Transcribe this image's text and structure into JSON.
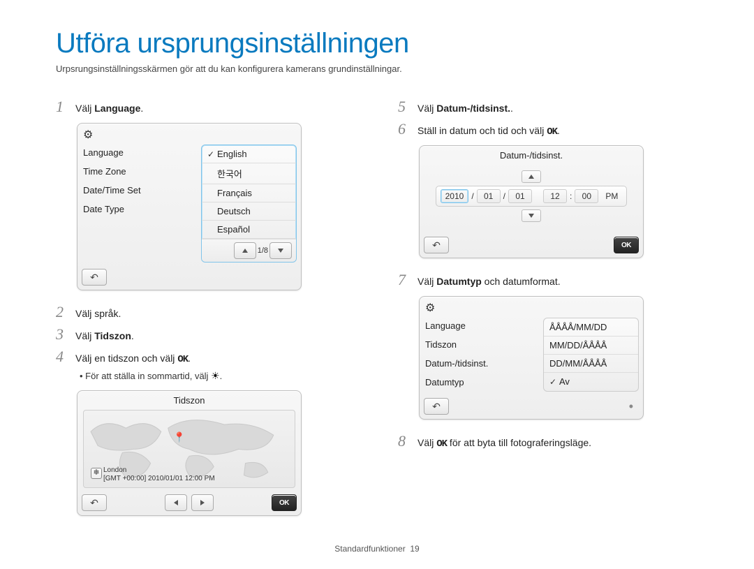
{
  "title": "Utföra ursprungsinställningen",
  "subtitle": "Urpsrungsinställningsskärmen gör att du kan konfigurera kamerans grundinställningar.",
  "footer": {
    "label": "Standardfunktioner",
    "page": "19"
  },
  "steps": {
    "s1": {
      "num": "1",
      "prefix": "Välj ",
      "bold": "Language",
      "suffix": "."
    },
    "s2": {
      "num": "2",
      "text": "Välj språk."
    },
    "s3": {
      "num": "3",
      "prefix": "Välj ",
      "bold": "Tidszon",
      "suffix": "."
    },
    "s4": {
      "num": "4",
      "prefix": "Välj en tidszon och välj ",
      "ok": "o",
      "suffix": "."
    },
    "s4_sub": "För att ställa in sommartid, välj ",
    "s5": {
      "num": "5",
      "prefix": "Välj ",
      "bold": "Datum-/tidsinst.",
      "suffix": "."
    },
    "s6": {
      "num": "6",
      "prefix": "Ställ in datum och tid och välj ",
      "ok": "o",
      "suffix": "."
    },
    "s7": {
      "num": "7",
      "prefix": "Välj ",
      "bold": "Datumtyp",
      "suffix": " och datumformat."
    },
    "s8": {
      "num": "8",
      "prefix": "Välj ",
      "ok": "o",
      "suffix": " för att byta till fotograferingsläge."
    }
  },
  "screen1": {
    "left": [
      "Language",
      "Time Zone",
      "Date/Time Set",
      "Date Type"
    ],
    "right": [
      "English",
      "한국어",
      "Français",
      "Deutsch",
      "Español"
    ],
    "check_index": 0,
    "pager": "1/8"
  },
  "screen2": {
    "title": "Tidszon",
    "city": "London",
    "gmt": "[GMT +00:00]  2010/01/01  12:00 PM"
  },
  "screen3": {
    "title": "Datum-/tidsinst.",
    "year": "2010",
    "month": "01",
    "day": "01",
    "hour": "12",
    "minute": "00",
    "ampm": "PM",
    "sep_date": "/",
    "sep_time": ":"
  },
  "screen4": {
    "left": [
      "Language",
      "Tidszon",
      "Datum-/tidsinst.",
      "Datumtyp"
    ],
    "right": [
      "ÅÅÅÅ/MM/DD",
      "MM/DD/ÅÅÅÅ",
      "DD/MM/ÅÅÅÅ",
      "Av"
    ],
    "check_index": 3
  },
  "ok_label": "OK"
}
